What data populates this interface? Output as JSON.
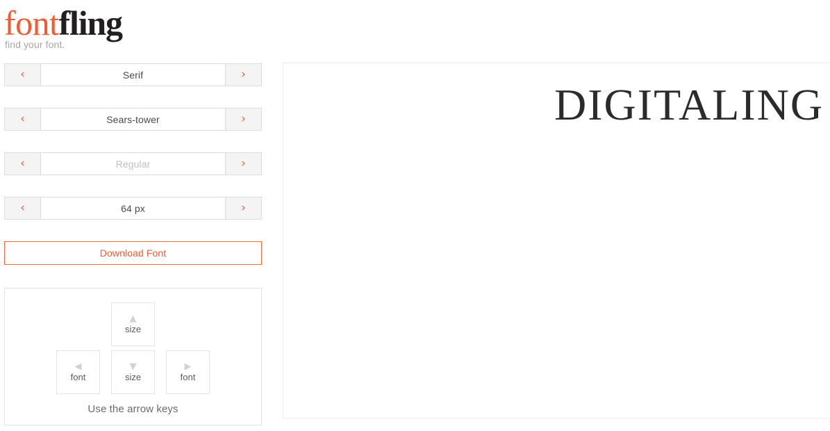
{
  "brand": {
    "name_part1": "font",
    "name_part2": "fling",
    "tagline": "find your font.",
    "accent_color": "#ef5c33",
    "dark_color": "#231f20",
    "tagline_color": "#a6a6a6"
  },
  "controls": {
    "prev_icon": "‹",
    "next_icon": "›",
    "rows": [
      {
        "name": "category",
        "value": "Serif",
        "muted": false
      },
      {
        "name": "font-family",
        "value": "Sears-tower",
        "muted": false
      },
      {
        "name": "font-weight",
        "value": "Regular",
        "muted": true
      },
      {
        "name": "font-size",
        "value": "64 px",
        "muted": false
      }
    ]
  },
  "download": {
    "label": "Download Font"
  },
  "hint": {
    "keys": {
      "up": {
        "glyph": "▲",
        "label": "size"
      },
      "left": {
        "glyph": "◀",
        "label": "font"
      },
      "down": {
        "glyph": "▼",
        "label": "size"
      },
      "right": {
        "glyph": "▶",
        "label": "font"
      }
    },
    "caption": "Use the arrow keys"
  },
  "preview": {
    "text": "DIGITALING"
  }
}
